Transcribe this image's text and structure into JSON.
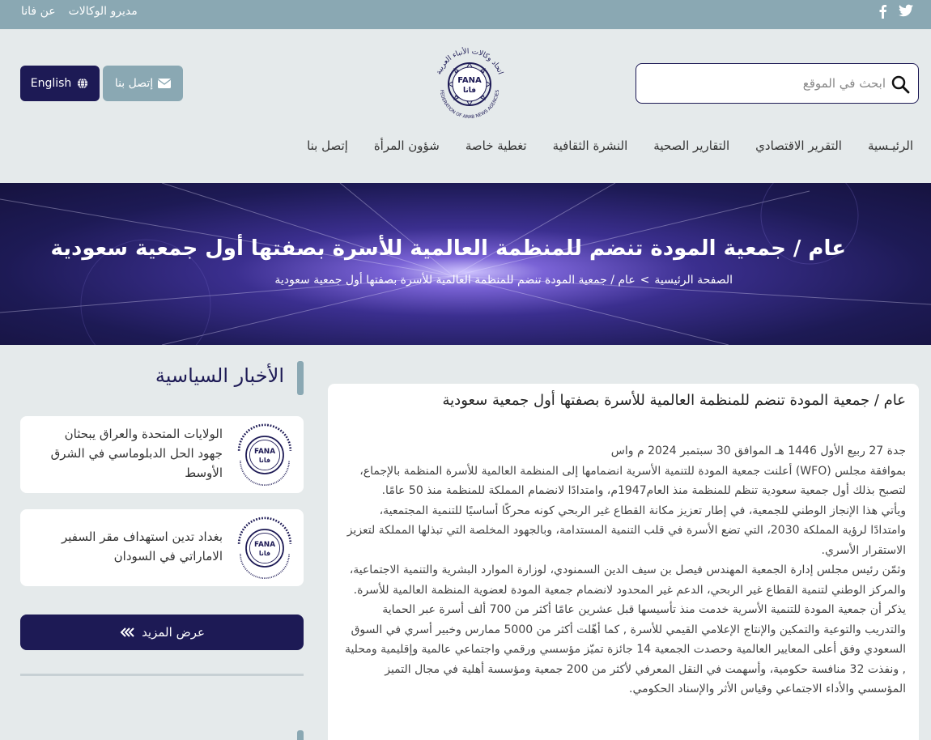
{
  "topbar": {
    "links": [
      "عن فانا",
      "مديرو الوكالات"
    ],
    "social": [
      {
        "icon": "twitter-icon"
      },
      {
        "icon": "facebook-icon"
      }
    ]
  },
  "header": {
    "search_placeholder": "ابحث في الموقع",
    "logo_alt": "FANA - Federation of Arab News Agencies",
    "logo_text_ar": "اتحاد وكالات الأنباء العربية",
    "logo_text_en": "FEDERATION OF ARAB NEWS AGENCIES",
    "contact_button": "إتصل بنا",
    "language_button": "English"
  },
  "nav": {
    "items": [
      "الرئيـسية",
      "التقرير الاقتصادي",
      "التقارير الصحية",
      "النشرة الثقافية",
      "تغطية خاصة",
      "شؤون المرأة",
      "إتصل بنا"
    ]
  },
  "hero": {
    "title": "عام / جمعية المودة تنضم للمنظمة العالمية للأسرة بصفتها أول جمعية سعودية",
    "breadcrumb_home": "الصفحة الرئيسية",
    "breadcrumb_sep": ">",
    "breadcrumb_current": "عام / جمعية المودة تنضم للمنظمة العالمية للأسرة بصفتها أول جمعية سعودية"
  },
  "article": {
    "title": "عام / جمعية المودة تنضم للمنظمة العالمية للأسرة بصفتها أول جمعية سعودية",
    "dateline": "جدة 27 ربيع الأول 1446 هـ الموافق 30 سبتمبر 2024 م واس",
    "paragraphs": [
      "بموافقة مجلس (WFO) أعلنت جمعية المودة للتنمية الأسرية انضمامها إلى المنظمة العالمية للأسرة المنظمة بالإجماع، لتصبح بذلك أول جمعية سعودية تنظم للمنظمة منذ العام1947م، وامتدادًا لانضمام المملكة للمنظمة منذ 50 عامًا.",
      "ويأتي هذا الإنجاز الوطني للجمعية، في إطار تعزيز مكانة القطاع غير الربحي كونه محركًا أساسيًا للتنمية المجتمعية، وامتدادًا لرؤية المملكة 2030، التي تضع الأسرة في قلب التنمية المستدامة، وبالجهود المخلصة التي تبذلها المملكة لتعزيز الاستقرار الأسري.",
      "وثمّن رئيس مجلس إدارة الجمعية المهندس فيصل بن سيف الدين السمنودي، لوزارة الموارد البشرية والتنمية الاجتماعية، والمركز الوطني لتنمية القطاع غير الربحي، الدعم غير المحدود لانضمام جمعية المودة لعضوية المنظمة العالمية للأسرة.",
      "يذكر أن جمعية المودة للتنمية الأسرية خدمت منذ تأسيسها قبل عشرين عامًا أكثر من 700 ألف أسرة عبر الحماية والتدريب والتوعية والتمكين والإنتاج الإعلامي القيمي للأسرة , كما أهّلت أكثر من 5000 ممارس وخبير أسري في السوق السعودي وفق أعلى المعايير العالمية وحصدت الجمعية 14 جائزة تميّز مؤسسي ورقمي واجتماعي عالمية وإقليمية ومحلية , ونفذت 32 منافسة حكومية، وأسهمت في النقل المعرفي لأكثر من 200 جمعية ومؤسسة أهلية في مجال التميز المؤسسي والأداء الاجتماعي وقياس الأثر والإسناد الحكومي."
    ]
  },
  "sidebar": {
    "section_title": "الأخبار السياسية",
    "cards": [
      {
        "title": "الولايات المتحدة والعراق يبحثان جهود الحل الدبلوماسي في الشرق الأوسط"
      },
      {
        "title": "بغداد تدين استهداف مقر السفير الاماراتي في السودان"
      }
    ],
    "more_button": "عرض المزيد"
  },
  "colors": {
    "navy": "#1d1a55",
    "teal": "#8aa8b3",
    "background": "#e5eaeb"
  }
}
